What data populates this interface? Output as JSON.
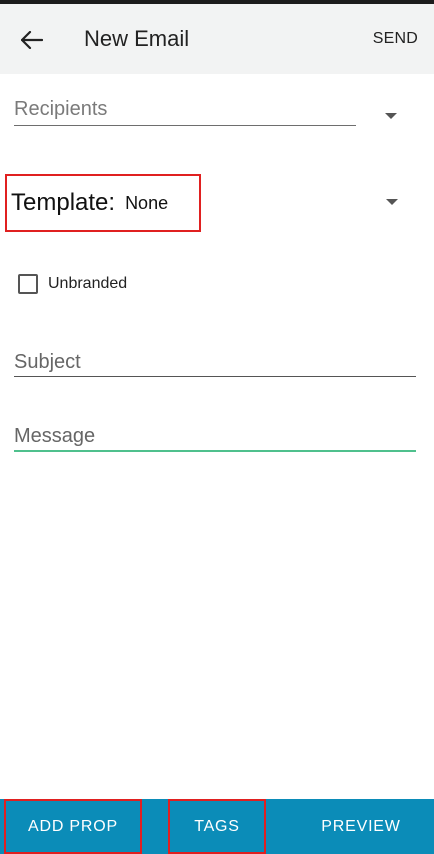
{
  "header": {
    "title": "New Email",
    "send_label": "SEND",
    "back_icon": "arrow-left-icon"
  },
  "form": {
    "recipients_placeholder": "Recipients",
    "template_label": "Template:",
    "template_value": "None",
    "unbranded_label": "Unbranded",
    "unbranded_checked": false,
    "subject_placeholder": "Subject",
    "message_placeholder": "Message"
  },
  "bottom_bar": {
    "add_prop_label": "ADD PROP",
    "tags_label": "TAGS",
    "preview_label": "PREVIEW"
  },
  "colors": {
    "app_bar": "#f2f3f3",
    "bottom_bar": "#0b8cb8",
    "focus_underline": "#4fc08d",
    "highlight_border": "#e02020"
  }
}
